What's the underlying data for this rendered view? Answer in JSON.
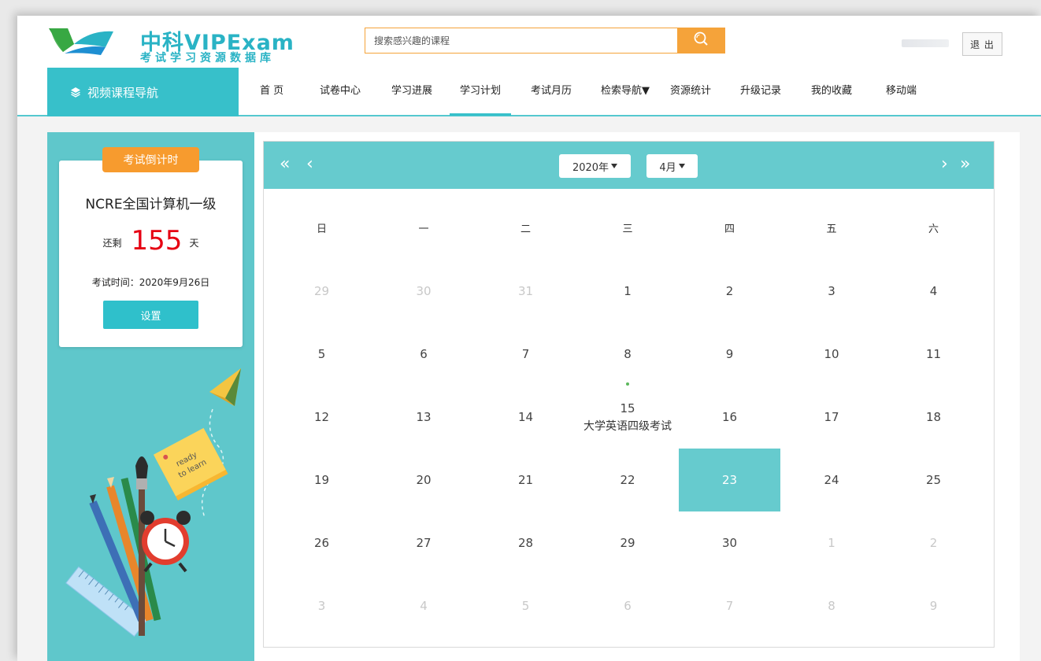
{
  "header": {
    "logo_title": "中科VIPExam",
    "logo_subtitle": "考试学习资源数据库",
    "search_placeholder": "搜索感兴趣的课程",
    "logout_label": "退 出"
  },
  "nav": {
    "video_nav_label": "视频课程导航",
    "items": [
      {
        "label": "首 页"
      },
      {
        "label": "试卷中心"
      },
      {
        "label": "学习进展"
      },
      {
        "label": "学习计划",
        "active": true
      },
      {
        "label": "考试月历"
      },
      {
        "label": "检索导航▼"
      },
      {
        "label": "资源统计"
      },
      {
        "label": "升级记录"
      },
      {
        "label": "我的收藏"
      },
      {
        "label": "移动端"
      }
    ],
    "accent_color": "#37c0ca"
  },
  "countdown": {
    "badge": "考试倒计时",
    "exam_name": "NCRE全国计算机一级",
    "remain_prefix": "还剩",
    "days": "155",
    "remain_suffix": "天",
    "exam_time": "考试时间：2020年9月26日",
    "set_button": "设置"
  },
  "illustration": {
    "sticky_note_text_1": "ready",
    "sticky_note_text_2": "to learn"
  },
  "calendar": {
    "year_select": "2020年",
    "month_select": "4月",
    "weekdays": [
      "日",
      "一",
      "二",
      "三",
      "四",
      "五",
      "六"
    ],
    "weeks": [
      [
        {
          "d": "29",
          "m": true
        },
        {
          "d": "30",
          "m": true
        },
        {
          "d": "31",
          "m": true
        },
        {
          "d": "1"
        },
        {
          "d": "2"
        },
        {
          "d": "3"
        },
        {
          "d": "4"
        }
      ],
      [
        {
          "d": "5"
        },
        {
          "d": "6"
        },
        {
          "d": "7"
        },
        {
          "d": "8"
        },
        {
          "d": "9"
        },
        {
          "d": "10"
        },
        {
          "d": "11"
        }
      ],
      [
        {
          "d": "12"
        },
        {
          "d": "13"
        },
        {
          "d": "14"
        },
        {
          "d": "15",
          "event": "大学英语四级考试"
        },
        {
          "d": "16"
        },
        {
          "d": "17"
        },
        {
          "d": "18"
        }
      ],
      [
        {
          "d": "19"
        },
        {
          "d": "20"
        },
        {
          "d": "21"
        },
        {
          "d": "22"
        },
        {
          "d": "23",
          "today": true
        },
        {
          "d": "24"
        },
        {
          "d": "25"
        }
      ],
      [
        {
          "d": "26"
        },
        {
          "d": "27"
        },
        {
          "d": "28"
        },
        {
          "d": "29"
        },
        {
          "d": "30"
        },
        {
          "d": "1",
          "m": true
        },
        {
          "d": "2",
          "m": true
        }
      ],
      [
        {
          "d": "3",
          "m": true
        },
        {
          "d": "4",
          "m": true
        },
        {
          "d": "5",
          "m": true
        },
        {
          "d": "6",
          "m": true
        },
        {
          "d": "7",
          "m": true
        },
        {
          "d": "8",
          "m": true
        },
        {
          "d": "9",
          "m": true
        }
      ]
    ],
    "header_color": "#66cbce",
    "today_color": "#66cbce"
  }
}
